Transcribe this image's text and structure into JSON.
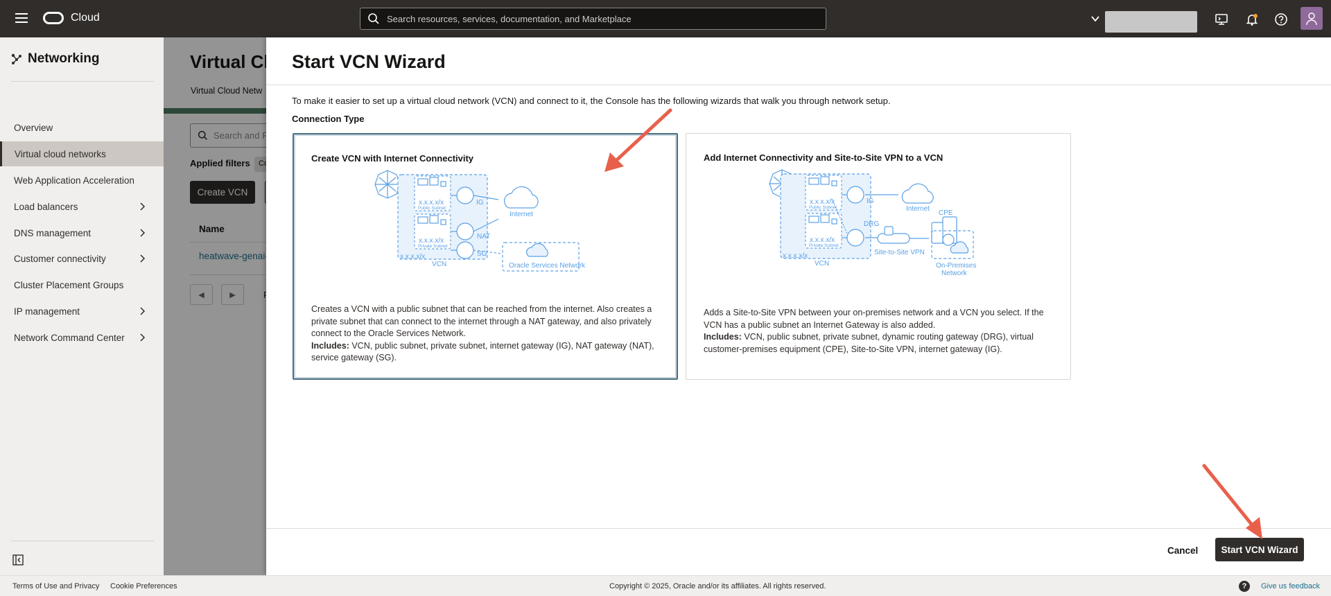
{
  "header": {
    "brand": "Cloud",
    "search_placeholder": "Search resources, services, documentation, and Marketplace"
  },
  "sidebar": {
    "title": "Networking",
    "items": [
      {
        "label": "Overview",
        "chevron": false,
        "active": false
      },
      {
        "label": "Virtual cloud networks",
        "chevron": false,
        "active": true
      },
      {
        "label": "Web Application Acceleration",
        "chevron": false,
        "active": false
      },
      {
        "label": "Load balancers",
        "chevron": true,
        "active": false
      },
      {
        "label": "DNS management",
        "chevron": true,
        "active": false
      },
      {
        "label": "Customer connectivity",
        "chevron": true,
        "active": false
      },
      {
        "label": "Cluster Placement Groups",
        "chevron": false,
        "active": false
      },
      {
        "label": "IP management",
        "chevron": true,
        "active": false
      },
      {
        "label": "Network Command Center",
        "chevron": true,
        "active": false
      }
    ]
  },
  "page": {
    "title": "Virtual Cl",
    "subtitle": "Virtual Cloud Netw",
    "search_placeholder": "Search and Fi",
    "applied_filters": "Applied filters",
    "filter_chip": "Co",
    "create_button": "Create VCN",
    "column_name": "Name",
    "row_link": "heatwave-genai-",
    "pager_text": "P"
  },
  "panel": {
    "title": "Start VCN Wizard",
    "intro": "To make it easier to set up a virtual cloud network (VCN) and connect to it, the Console has the following wizards that walk you through network setup.",
    "connection_type": "Connection Type",
    "cards": [
      {
        "title": "Create VCN with Internet Connectivity",
        "description": "Creates a VCN with a public subnet that can be reached from the internet. Also creates a private subnet that can connect to the internet through a NAT gateway, and also privately connect to the Oracle Services Network.",
        "includes_label": "Includes:",
        "includes": " VCN, public subnet, private subnet, internet gateway (IG), NAT gateway (NAT), service gateway (SG).",
        "selected": true,
        "diagram": {
          "cidr1": "x.x.x.x/x",
          "public_subnet": "Public Subnet",
          "cidr2": "x.x.x.x/x",
          "private_subnet": "Private Subnet",
          "cidr3": "x.x.x.x/x",
          "vcn": "VCN",
          "ig": "IG",
          "nat": "NAT",
          "sg": "SG",
          "internet": "Internet",
          "osn": "Oracle Services Network"
        }
      },
      {
        "title": "Add Internet Connectivity and Site-to-Site VPN to a VCN",
        "description": "Adds a Site-to-Site VPN between your on-premises network and a VCN you select. If the VCN has a public subnet an Internet Gateway is also added.",
        "includes_label": "Includes:",
        "includes": " VCN, public subnet, private subnet, dynamic routing gateway (DRG), virtual customer-premises equipment (CPE), Site-to-Site VPN, internet gateway (IG).",
        "selected": false,
        "diagram": {
          "cidr1": "x.x.x.x/x",
          "public_subnet": "Public Subnet",
          "cidr2": "x.x.x.x/x",
          "private_subnet": "Private Subnet",
          "cidr3": "x.x.x.x/x",
          "vcn": "VCN",
          "ig": "IG",
          "drg": "DRG",
          "internet": "Internet",
          "vpn": "Site-to-Site VPN",
          "cpe": "CPE",
          "onprem1": "On-Premises",
          "onprem2": "Network"
        }
      }
    ],
    "cancel": "Cancel",
    "start_button": "Start VCN Wizard"
  },
  "footer": {
    "terms": "Terms of Use and Privacy",
    "cookies": "Cookie Preferences",
    "copyright": "Copyright © 2025, Oracle and/or its affiliates. All rights reserved.",
    "feedback": "Give us feedback"
  },
  "colors": {
    "topbar": "#312d2a",
    "diagram_blue": "#5aa0e6",
    "link": "#1e6e8e",
    "annotation_arrow": "#e8604c"
  }
}
